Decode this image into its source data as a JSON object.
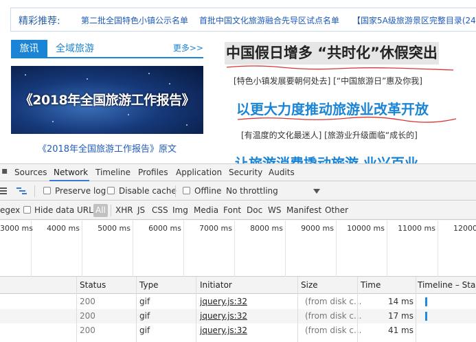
{
  "web": {
    "recommend_label": "精彩推荐:",
    "recommend_links": [
      "第二批全国特色小镇公示名单",
      "首批中国文化旅游融合先导区试点名单",
      "【国家5A级旅游景区完整目录(249"
    ],
    "tabs": [
      "旅讯",
      "全域旅游"
    ],
    "more": "更多>>",
    "banner_title": "《2018年全国旅游工作报告》",
    "caption": "《2018年全国旅游工作报告》原文",
    "headline": "中国假日增多  “共时化”休假突出",
    "sub1": "[特色小镇发展要朝何处去] [“中国旅游日”惠及你我]",
    "headline2": "以更大力度推动旅游业改革开放",
    "sub2": "[有温度的文化最迷人] [旅游业升级面临“成长的]",
    "headline3": "让旅游消费撬动旅游  业兴百业"
  },
  "devtools": {
    "tabs": [
      "Sources",
      "Network",
      "Timeline",
      "Profiles",
      "Application",
      "Security",
      "Audits"
    ],
    "active_tab": "Network",
    "toolbar": {
      "preserve_log": "Preserve log",
      "disable_cache": "Disable cache",
      "offline": "Offline",
      "throttling": "No throttling"
    },
    "filter": {
      "regex": "egex",
      "hide_data_urls": "Hide data URLs",
      "types": [
        "All",
        "XHR",
        "JS",
        "CSS",
        "Img",
        "Media",
        "Font",
        "Doc",
        "WS",
        "Manifest",
        "Other"
      ]
    },
    "overview_ticks": [
      "3000 ms",
      "4000 ms",
      "5000 ms",
      "6000 ms",
      "7000 ms",
      "8000 ms",
      "9000 ms",
      "10000 ms",
      "11000 ms",
      "12000"
    ],
    "columns": [
      "Status",
      "Type",
      "Initiator",
      "Size",
      "Time",
      "Timeline – Start T"
    ],
    "rows": [
      {
        "status": "200",
        "type": "gif",
        "initiator": "jquery.js:32",
        "size": "(from disk c...",
        "time": "14 ms"
      },
      {
        "status": "200",
        "type": "gif",
        "initiator": "jquery.js:32",
        "size": "(from disk c...",
        "time": "17 ms"
      },
      {
        "status": "200",
        "type": "gif",
        "initiator": "jquery.js:32",
        "size": "(from disk c...",
        "time": "41 ms"
      }
    ],
    "colors": {
      "accent": "#3879d9",
      "timeline_bar": "#1e88e5"
    }
  }
}
